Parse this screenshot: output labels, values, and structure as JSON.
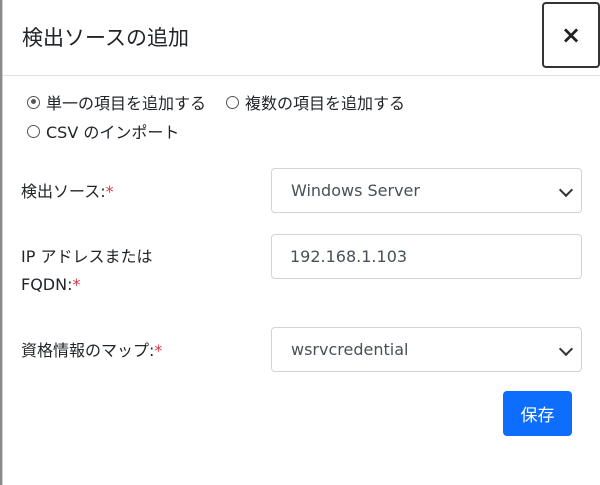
{
  "dialog": {
    "title": "検出ソースの追加",
    "close_label": "×"
  },
  "options": {
    "single": "単一の項目を追加する",
    "multiple": "複数の項目を追加する",
    "csv": "CSV のインポート",
    "selected": "single"
  },
  "form": {
    "source_label": "検出ソース:",
    "source_value": "Windows Server",
    "ip_label_line1": "IP アドレスまたは",
    "ip_label_line2": "FQDN:",
    "ip_value": "192.168.1.103",
    "credential_label": "資格情報のマップ:",
    "credential_value": "wsrvcredential",
    "required_mark": "*"
  },
  "actions": {
    "save_label": "保存"
  }
}
